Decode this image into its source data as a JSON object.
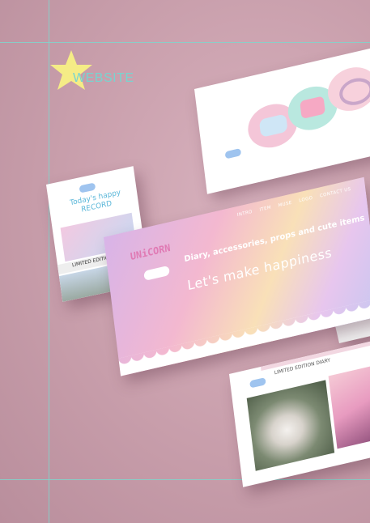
{
  "header": {
    "website_label": "WEBSITE"
  },
  "mobile_card": {
    "title": "Today's happy RECORD",
    "section_label": "LIMITED EDITION DIARY"
  },
  "hero_card": {
    "logo": "UNiCORN",
    "nav": [
      "INTRO",
      "ITEM",
      "MUSE",
      "LOGO",
      "CONTACT US"
    ],
    "subtitle": "Diary, accessories, props and cute items",
    "title": "Let's make happiness"
  },
  "bottom_card": {
    "title": "LIMITED EDITION DIARY"
  },
  "colors": {
    "background": "#c89eab",
    "guide": "#7fd6cc",
    "star": "#f5ec86",
    "accent_teal": "#78d4cf",
    "logo_pink": "#e07ab4"
  },
  "icons": [
    "star-icon",
    "cloud-icon"
  ]
}
